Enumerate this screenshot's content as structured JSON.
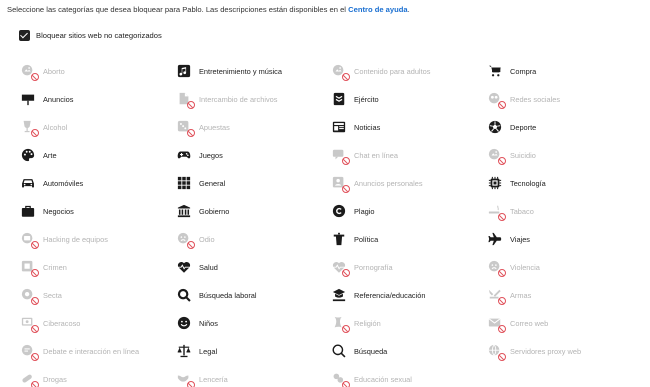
{
  "intro": {
    "text": "Seleccione las categorías que desea bloquear para Pablo. Las descripciones están disponibles en el ",
    "link": "Centro de ayuda",
    "after": "."
  },
  "uncategorized": {
    "label": "Bloquear sitios web no categorizados",
    "checked": true
  },
  "colors": {
    "blocked_icon": "#c9c9c9",
    "blocked_text": "#b4b4b4",
    "ban": "#e0505a",
    "link": "#1a6fd1"
  },
  "categories": [
    {
      "label": "Aborto",
      "blocked": true,
      "icon": "generic-icon"
    },
    {
      "label": "Entretenimiento y música",
      "blocked": false,
      "icon": "music-icon"
    },
    {
      "label": "Contenido para adultos",
      "blocked": true,
      "icon": "adult-icon"
    },
    {
      "label": "Compra",
      "blocked": false,
      "icon": "cart-icon"
    },
    {
      "label": "Anuncios",
      "blocked": false,
      "icon": "billboard-icon"
    },
    {
      "label": "Intercambio de archivos",
      "blocked": true,
      "icon": "file-icon"
    },
    {
      "label": "Ejército",
      "blocked": false,
      "icon": "military-icon"
    },
    {
      "label": "Redes sociales",
      "blocked": true,
      "icon": "social-icon"
    },
    {
      "label": "Alcohol",
      "blocked": true,
      "icon": "alcohol-icon"
    },
    {
      "label": "Apuestas",
      "blocked": true,
      "icon": "dice-icon"
    },
    {
      "label": "Noticias",
      "blocked": false,
      "icon": "news-icon"
    },
    {
      "label": "Deporte",
      "blocked": false,
      "icon": "ball-icon"
    },
    {
      "label": "Arte",
      "blocked": false,
      "icon": "palette-icon"
    },
    {
      "label": "Juegos",
      "blocked": false,
      "icon": "gamepad-icon"
    },
    {
      "label": "Chat en línea",
      "blocked": true,
      "icon": "chat-icon"
    },
    {
      "label": "Suicidio",
      "blocked": true,
      "icon": "generic-icon"
    },
    {
      "label": "Automóviles",
      "blocked": false,
      "icon": "car-icon"
    },
    {
      "label": "General",
      "blocked": false,
      "icon": "grid-icon"
    },
    {
      "label": "Anuncios personales",
      "blocked": true,
      "icon": "personal-icon"
    },
    {
      "label": "Tecnología",
      "blocked": false,
      "icon": "chip-icon"
    },
    {
      "label": "Negocios",
      "blocked": false,
      "icon": "briefcase-icon"
    },
    {
      "label": "Gobierno",
      "blocked": false,
      "icon": "government-icon"
    },
    {
      "label": "Plagio",
      "blocked": false,
      "icon": "copyright-icon"
    },
    {
      "label": "Tabaco",
      "blocked": true,
      "icon": "tobacco-icon"
    },
    {
      "label": "Hacking de equipos",
      "blocked": true,
      "icon": "hacking-icon"
    },
    {
      "label": "Odio",
      "blocked": true,
      "icon": "hate-icon"
    },
    {
      "label": "Política",
      "blocked": false,
      "icon": "podium-icon"
    },
    {
      "label": "Viajes",
      "blocked": false,
      "icon": "airplane-icon"
    },
    {
      "label": "Crimen",
      "blocked": true,
      "icon": "crime-icon"
    },
    {
      "label": "Salud",
      "blocked": false,
      "icon": "heart-icon"
    },
    {
      "label": "Pornografía",
      "blocked": true,
      "icon": "heart-icon"
    },
    {
      "label": "Violencia",
      "blocked": true,
      "icon": "violence-icon"
    },
    {
      "label": "Secta",
      "blocked": true,
      "icon": "sect-icon"
    },
    {
      "label": "Búsqueda laboral",
      "blocked": false,
      "icon": "job-search-icon"
    },
    {
      "label": "Referencia/educación",
      "blocked": false,
      "icon": "graduation-icon"
    },
    {
      "label": "Armas",
      "blocked": true,
      "icon": "weapons-icon"
    },
    {
      "label": "Ciberacoso",
      "blocked": true,
      "icon": "cyberbullying-icon"
    },
    {
      "label": "Niños",
      "blocked": false,
      "icon": "smiley-icon"
    },
    {
      "label": "Religión",
      "blocked": true,
      "icon": "religion-icon"
    },
    {
      "label": "Correo web",
      "blocked": true,
      "icon": "mail-icon"
    },
    {
      "label": "Debate e interacción en línea",
      "blocked": true,
      "icon": "debate-icon"
    },
    {
      "label": "Legal",
      "blocked": false,
      "icon": "scales-icon"
    },
    {
      "label": "Búsqueda",
      "blocked": false,
      "icon": "search-icon"
    },
    {
      "label": "Servidores proxy web",
      "blocked": true,
      "icon": "proxy-icon"
    },
    {
      "label": "Drogas",
      "blocked": true,
      "icon": "drugs-icon"
    },
    {
      "label": "Lencería",
      "blocked": true,
      "icon": "lingerie-icon"
    },
    {
      "label": "Educación sexual",
      "blocked": true,
      "icon": "sex-ed-icon"
    }
  ]
}
